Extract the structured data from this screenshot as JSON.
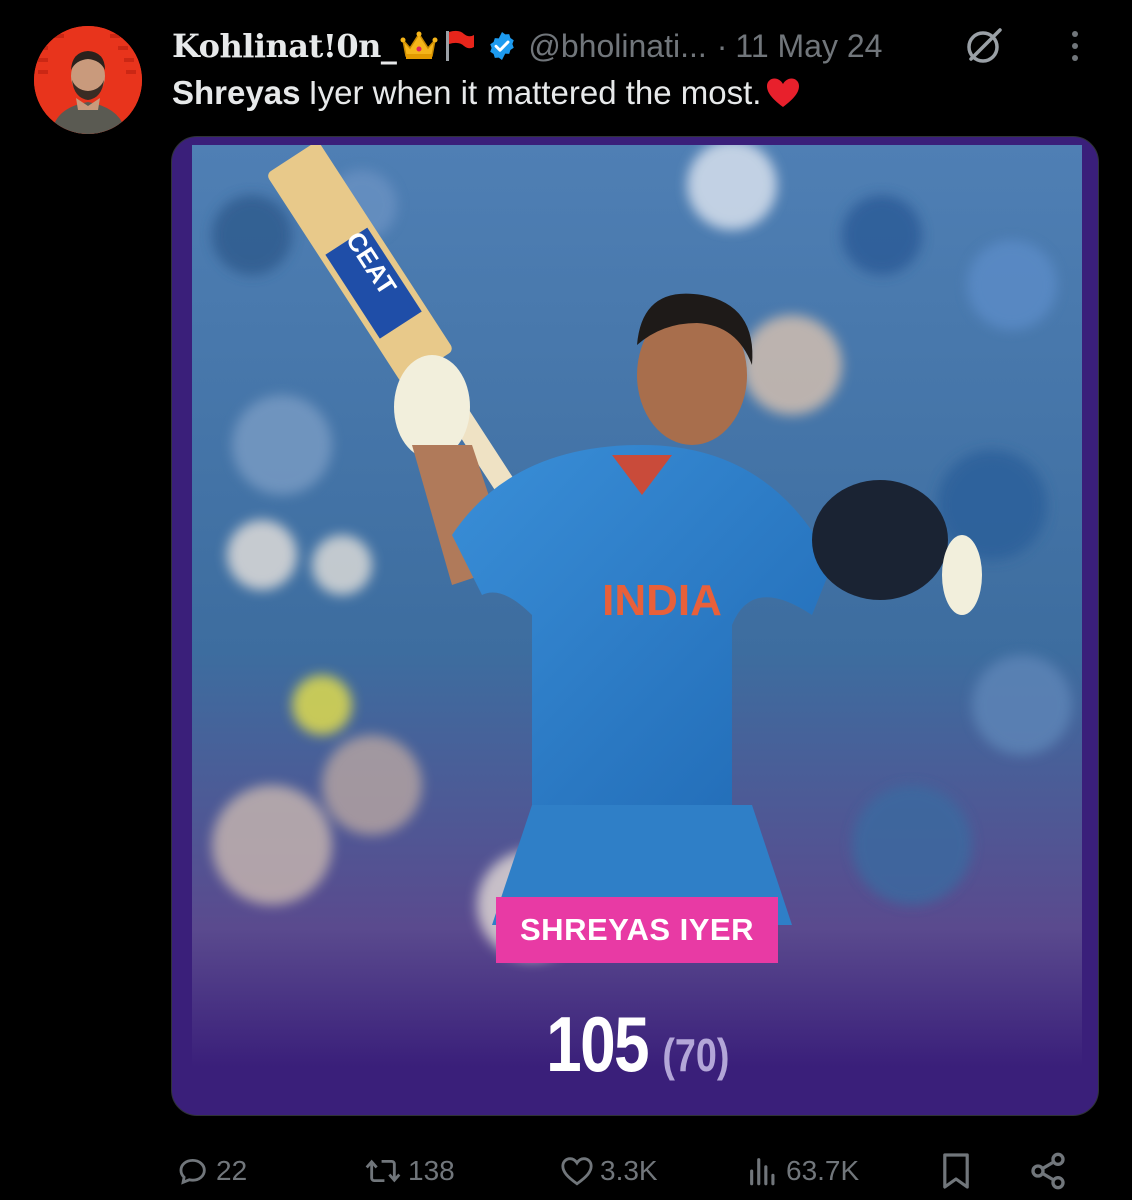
{
  "post": {
    "display_name": "Kohlinat!0n_",
    "name_emojis": [
      "crown-emoji",
      "red-flag-emoji"
    ],
    "verified": true,
    "handle": "@bholinati...",
    "separator": "·",
    "date": "11 May 24",
    "text_bold": "Shreyas",
    "text_rest": "Iyer when it mattered the most.",
    "text_emoji": "red-heart-emoji"
  },
  "media": {
    "player_name": "SHREYAS IYER",
    "runs": "105",
    "balls": "(70)",
    "jersey_text": "INDIA",
    "bat_brand": "CEAT"
  },
  "actions": {
    "replies": "22",
    "reposts": "138",
    "likes": "3.3K",
    "views": "63.7K"
  },
  "colors": {
    "background": "#000000",
    "text_primary": "#e7e9ea",
    "text_secondary": "#71767b",
    "verified_blue": "#1d9bf0",
    "card_purple": "#3a1f7a",
    "name_plate_pink": "#e83aa4"
  },
  "icons": [
    "grok-icon",
    "more-icon",
    "reply-icon",
    "repost-icon",
    "like-icon",
    "views-icon",
    "bookmark-icon",
    "share-icon"
  ]
}
